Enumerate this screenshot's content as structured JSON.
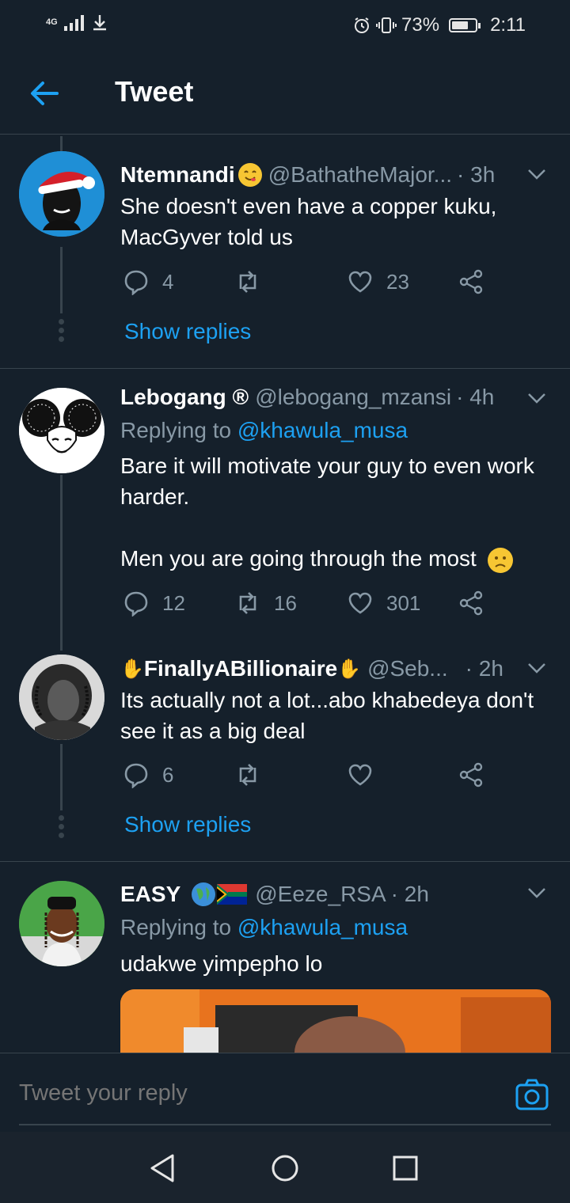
{
  "status_bar": {
    "network": "4G",
    "battery_text": "73%",
    "battery_level": 0.73,
    "time": "2:11"
  },
  "header": {
    "title": "Tweet"
  },
  "tweets": [
    {
      "name": "Ntemnandi",
      "handle": "@BathatheMajor...",
      "time": "· 3h",
      "text": "She doesn't even have a copper kuku, MacGyver told us",
      "replies": "4",
      "retweets": "",
      "likes": "23",
      "show_replies": "Show replies"
    },
    {
      "name": "Lebogang ®",
      "handle": "@lebogang_mzansi",
      "time": "· 4h",
      "reply_prefix": "Replying to",
      "reply_to": "@khawula_musa",
      "text_line1": "Bare it will motivate your guy to even work harder.",
      "text_line2": "Men you are going through the most",
      "replies": "12",
      "retweets": "16",
      "likes": "301"
    },
    {
      "name": "FinallyABillionaire",
      "handle": "@Seb...",
      "time": "· 2h",
      "text": "Its actually not a lot...abo khabedeya don't see it as a big deal",
      "replies": "6",
      "retweets": "",
      "likes": "",
      "show_replies": "Show replies"
    },
    {
      "name": "EASY",
      "handle": "@Eeze_RSA",
      "time": "· 2h",
      "reply_prefix": "Replying to",
      "reply_to": "@khawula_musa",
      "text": "udakwe yimpepho lo"
    }
  ],
  "reply_bar": {
    "placeholder": "Tweet your reply"
  },
  "colors": {
    "background": "#15202b",
    "accent": "#1da1f2",
    "muted": "#8899a6",
    "divider": "#38444d"
  }
}
